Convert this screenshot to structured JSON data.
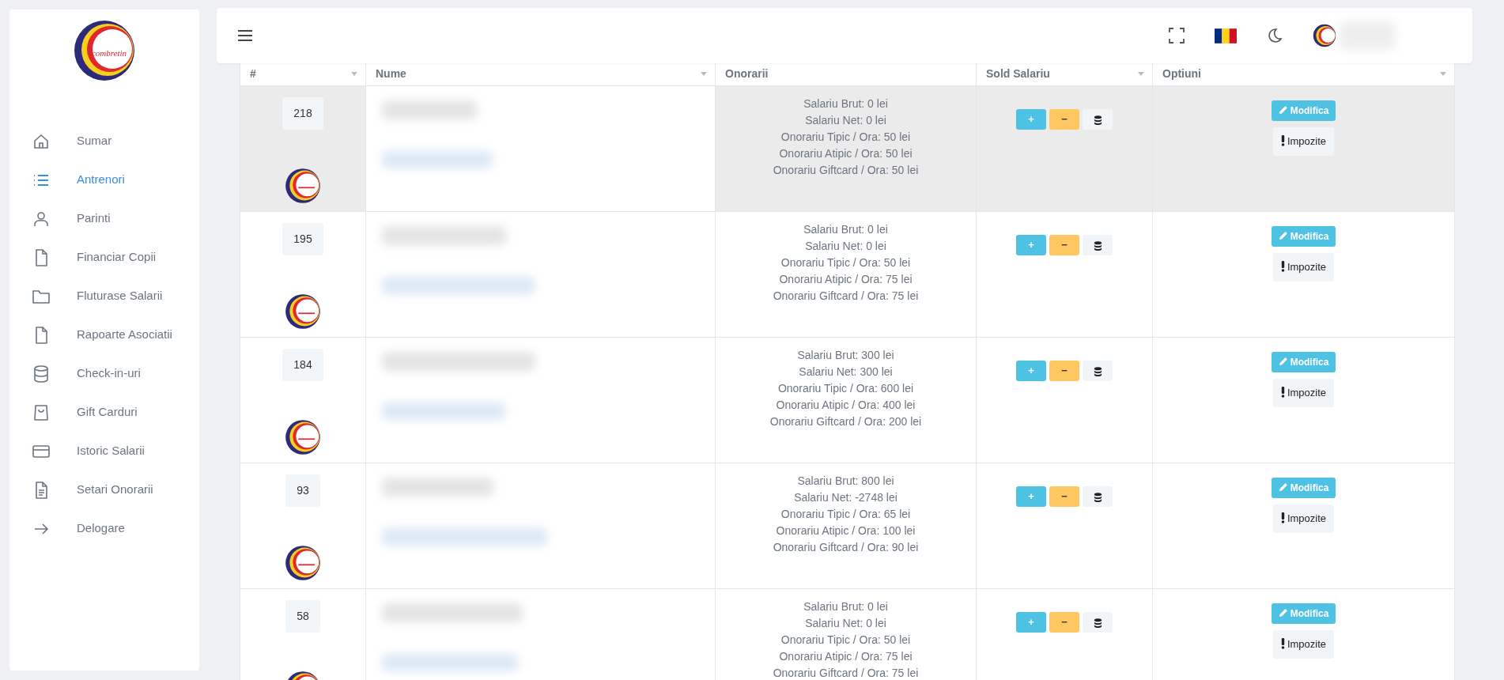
{
  "sidebar": {
    "logo_text": "combretin",
    "items": [
      {
        "label": "Sumar",
        "kind": "home",
        "selected": false
      },
      {
        "label": "Antrenori",
        "kind": "list",
        "selected": true
      },
      {
        "label": "Parinti",
        "kind": "user",
        "selected": false
      },
      {
        "label": "Financiar Copii",
        "kind": "file",
        "selected": false
      },
      {
        "label": "Fluturase Salarii",
        "kind": "folder",
        "selected": false
      },
      {
        "label": "Rapoarte Asociatii",
        "kind": "file",
        "selected": false
      },
      {
        "label": "Check-in-uri",
        "kind": "database",
        "selected": false
      },
      {
        "label": "Gift Carduri",
        "kind": "bag",
        "selected": false
      },
      {
        "label": "Istoric Salarii",
        "kind": "card",
        "selected": false
      },
      {
        "label": "Setari Onorarii",
        "kind": "doc",
        "selected": false
      },
      {
        "label": "Delogare",
        "kind": "arrow",
        "selected": false
      }
    ]
  },
  "table": {
    "columns": [
      "#",
      "Nume",
      "Onorarii",
      "Sold Salariu",
      "Optiuni"
    ],
    "rows": [
      {
        "id": "218",
        "highlighted": true,
        "onorarii": [
          "Salariu Brut: 0 lei",
          "Salariu Net: 0 lei",
          "Onorariu Tipic / Ora: 50 lei",
          "Onorariu Atipic / Ora: 50 lei",
          "Onorariu Giftcard / Ora: 50 lei"
        ],
        "sold_buttons": [
          "+",
          "−"
        ],
        "option_buttons": [
          "Modifica",
          "Impozite"
        ]
      },
      {
        "id": "195",
        "highlighted": false,
        "onorarii": [
          "Salariu Brut: 0 lei",
          "Salariu Net: 0 lei",
          "Onorariu Tipic / Ora: 50 lei",
          "Onorariu Atipic / Ora: 75 lei",
          "Onorariu Giftcard / Ora: 75 lei"
        ],
        "sold_buttons": [
          "+",
          "−"
        ],
        "option_buttons": [
          "Modifica",
          "Impozite"
        ]
      },
      {
        "id": "184",
        "highlighted": false,
        "onorarii": [
          "Salariu Brut: 300 lei",
          "Salariu Net: 300 lei",
          "Onorariu Tipic / Ora: 600 lei",
          "Onorariu Atipic / Ora: 400 lei",
          "Onorariu Giftcard / Ora: 200 lei"
        ],
        "sold_buttons": [
          "+",
          "−"
        ],
        "option_buttons": [
          "Modifica",
          "Impozite"
        ]
      },
      {
        "id": "93",
        "highlighted": false,
        "onorarii": [
          "Salariu Brut: 800 lei",
          "Salariu Net: -2748 lei",
          "Onorariu Tipic / Ora: 65 lei",
          "Onorariu Atipic / Ora: 100 lei",
          "Onorariu Giftcard / Ora: 90 lei"
        ],
        "sold_buttons": [
          "+",
          "−"
        ],
        "option_buttons": [
          "Modifica",
          "Impozite"
        ]
      },
      {
        "id": "58",
        "highlighted": false,
        "onorarii": [
          "Salariu Brut: 0 lei",
          "Salariu Net: 0 lei",
          "Onorariu Tipic / Ora: 50 lei",
          "Onorariu Atipic / Ora: 75 lei",
          "Onorariu Giftcard / Ora: 75 lei"
        ],
        "sold_buttons": [
          "+",
          "−"
        ],
        "option_buttons": [
          "Modifica",
          "Impozite"
        ]
      }
    ]
  }
}
